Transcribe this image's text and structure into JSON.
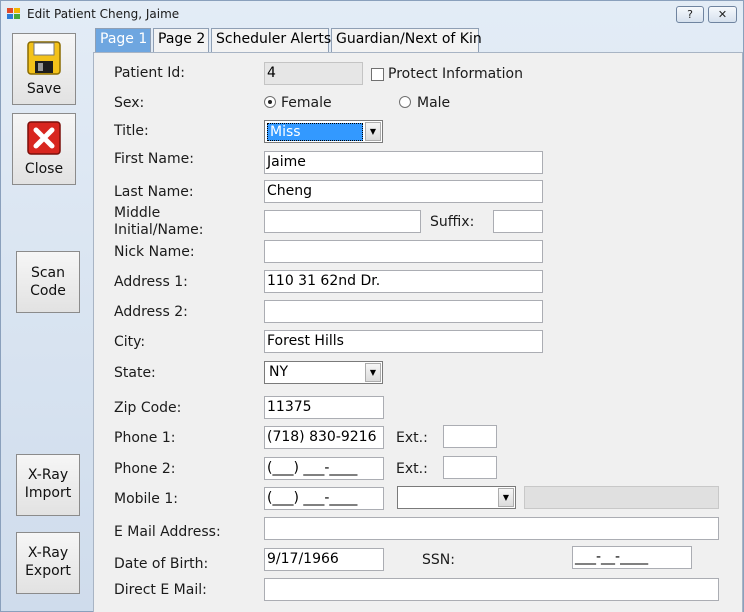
{
  "window": {
    "title": "Edit Patient Cheng, Jaime",
    "help_label": "?",
    "close_label": "✕"
  },
  "sidebar": {
    "save_label": "Save",
    "close_label": "Close",
    "scan_label": "Scan\nCode",
    "xray_import_label": "X-Ray\nImport",
    "xray_export_label": "X-Ray\nExport"
  },
  "tabs": [
    {
      "label": "Page 1"
    },
    {
      "label": "Page 2"
    },
    {
      "label": "Scheduler Alerts"
    },
    {
      "label": "Guardian/Next of Kin"
    }
  ],
  "form": {
    "patient_id_label": "Patient Id:",
    "patient_id": "4",
    "protect_label": "Protect Information",
    "sex_label": "Sex:",
    "female_label": "Female",
    "male_label": "Male",
    "sex_selected": "Female",
    "title_label": "Title:",
    "title_value": "Miss",
    "first_name_label": "First Name:",
    "first_name": "Jaime",
    "last_name_label": "Last Name:",
    "last_name": "Cheng",
    "middle_label_1": "Middle",
    "middle_label_2": "Initial/Name:",
    "middle": "",
    "suffix_label": "Suffix:",
    "suffix": "",
    "nick_label": "Nick Name:",
    "nick": "",
    "address1_label": "Address 1:",
    "address1": "110 31 62nd Dr.",
    "address2_label": "Address 2:",
    "address2": "",
    "city_label": "City:",
    "city": "Forest Hills",
    "state_label": "State:",
    "state": "NY",
    "zip_label": "Zip Code:",
    "zip": "11375",
    "phone1_label": "Phone 1:",
    "phone1": "(718) 830-9216",
    "ext_label": "Ext.:",
    "phone1_ext": "",
    "phone2_label": "Phone 2:",
    "phone2": "(___) ___-____",
    "phone2_ext": "",
    "mobile1_label": "Mobile 1:",
    "mobile1": "(___) ___-____",
    "mobile_carrier": "",
    "email_label": "E Mail Address:",
    "email": "",
    "dob_label": "Date of Birth:",
    "dob": "9/17/1966",
    "ssn_label": "SSN:",
    "ssn": "___-__-____",
    "direct_email_label": "Direct E Mail:",
    "direct_email": ""
  }
}
